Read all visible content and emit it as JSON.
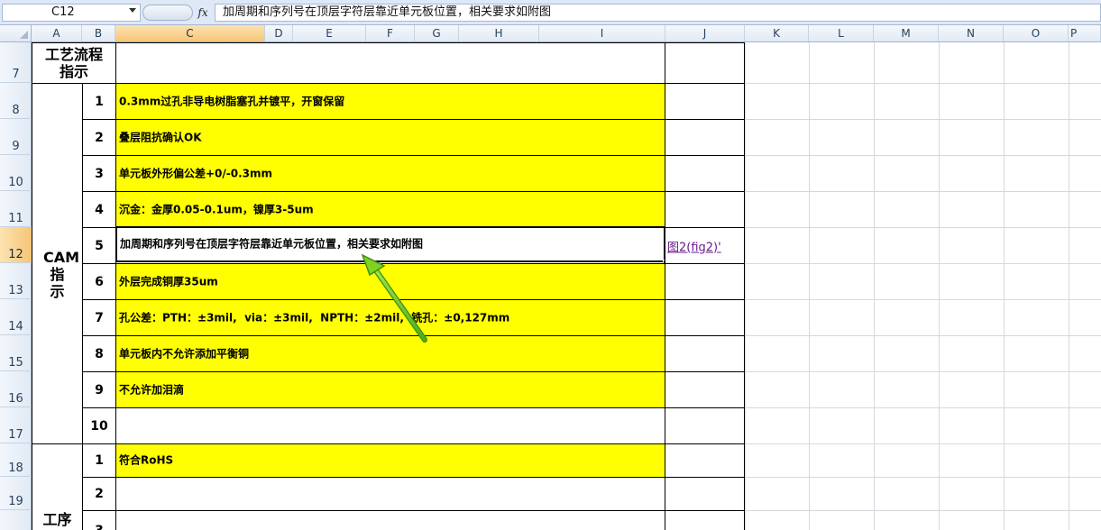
{
  "formula_bar": {
    "name_box": "C12",
    "fx_label": "fx",
    "formula": "加周期和序列号在顶层字符层靠近单元板位置，相关要求如附图"
  },
  "columns": [
    "A",
    "B",
    "C",
    "D",
    "E",
    "F",
    "G",
    "H",
    "I",
    "J",
    "K",
    "L",
    "M",
    "N",
    "O",
    "P"
  ],
  "rows": [
    "7",
    "8",
    "9",
    "10",
    "11",
    "12",
    "13",
    "14",
    "15",
    "16",
    "17",
    "18",
    "19"
  ],
  "sheet": {
    "section_process": "工艺流程指示",
    "section_cam": "CAM指示",
    "section_procedure": "工序",
    "cam_items": [
      {
        "num": "1",
        "text": "0.3mm过孔非导电树脂塞孔并镀平，开窗保留"
      },
      {
        "num": "2",
        "text": "叠层阻抗确认OK"
      },
      {
        "num": "3",
        "text": "单元板外形偏公差+0/-0.3mm"
      },
      {
        "num": "4",
        "text": "沉金：金厚0.05-0.1um，镍厚3-5um"
      },
      {
        "num": "5",
        "text": "加周期和序列号在顶层字符层靠近单元板位置，相关要求如附图"
      },
      {
        "num": "6",
        "text": "外层完成铜厚35um"
      },
      {
        "num": "7",
        "text": "孔公差：PTH：±3mil,  via：±3mil,  NPTH：±2mil,  铣孔：±0,127mm"
      },
      {
        "num": "8",
        "text": "单元板内不允许添加平衡铜"
      },
      {
        "num": "9",
        "text": "不允许加泪滴"
      },
      {
        "num": "10",
        "text": ""
      }
    ],
    "procedure_items": [
      {
        "num": "1",
        "text": "符合RoHS"
      },
      {
        "num": "2",
        "text": ""
      },
      {
        "num": "3",
        "text": ""
      }
    ],
    "link_text": "图2(fig2)'"
  },
  "colors": {
    "highlight": "#ffff00",
    "link": "#6a1b8a",
    "arrow": "#7ed321"
  }
}
